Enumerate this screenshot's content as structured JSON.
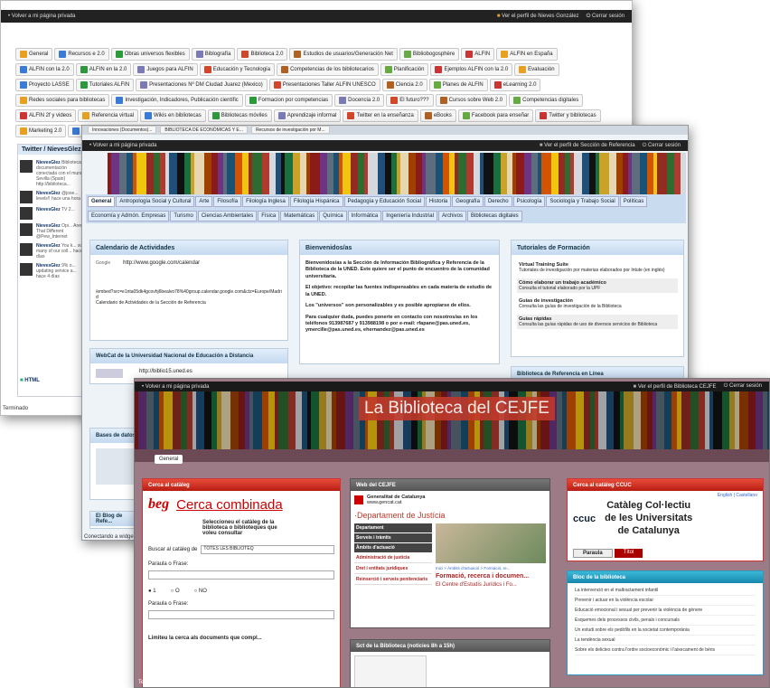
{
  "win1": {
    "topbar_left": "• Volver a mi página privada",
    "topbar_profile": "Ver el perfil de Nieves González",
    "topbar_logout": "Cerrar sesión",
    "tabs": [
      "General",
      "Recursos e 2.0",
      "Obras universos flexibles",
      "Biblografía",
      "Biblioteca 2.0",
      "Estudios de usuarios/Generación Net",
      "Bibliobogosphère",
      "ALFIN",
      "ALFIN en España",
      "ALFIN con la 2.0",
      "ALFIN en la 2.0",
      "Juegos para ALFIN",
      "Educación y Tecnología",
      "Competencias de los bibliotecarios",
      "Planificación",
      "Ejemplos ALFIN con la 2.0",
      "Evaluación",
      "Proyecto LASSE",
      "Tutoriales ALFIN",
      "Presentaciones Nº DM Ciudad Juarez (Mexico)",
      "Presentaciones Taller ALFIN UNESCO",
      "Ciencia 2.0",
      "Planes de ALFIN",
      "eLearning 2.0",
      "Redes sociales para bibliotecas",
      "Investigación, Indicadores, Publicación científic",
      "Formacion por competencias",
      "Docencia 2.0",
      "El futuro???",
      "Cursos sobre Web 2.0",
      "Competencias digitales",
      "ALFIN 2f y videos",
      "Referencia virtual",
      "Wikis en bibliotecas",
      "Bibliotecas móviles",
      "Aprendizaje informal",
      "Twitter en la enseñanza",
      "eBooks",
      "Facebook para enseñar",
      "Twitter y bibliotecas",
      "Marketing 2.0",
      "Futuro de la tecnología"
    ],
    "twitter_title": "Twitter / NievesGlez",
    "tweets": [
      {
        "user": "NievesGlez",
        "text": "Biblioteca y documentación conectada con el mundo: Sevilla (Spain) http://biblioteca..."
      },
      {
        "user": "NievesGlez",
        "text": "@jose... levels!! hace una hora"
      },
      {
        "user": "NievesGlez",
        "text": "TV 2..."
      },
      {
        "user": "NievesGlez",
        "text": "Opi... Aren't That Different @Pew_Internet"
      },
      {
        "user": "NievesGlez",
        "text": "You k... so many of our coll... hace 4 días"
      },
      {
        "user": "NievesGlez",
        "text": "9% o... updating service a... hace 4 días"
      }
    ],
    "html_label": "HTML",
    "status": "Terminado"
  },
  "win2": {
    "browser_tabs": [
      "Innovaciones (Documentos)...",
      "BIBLIOTECA DE ECONÓMICAS Y E...",
      "Recursos de investigación por M..."
    ],
    "topbar_left": "• Volver a mi página privada",
    "topbar_profile": "Ver el perfil de Sección de Referencia",
    "topbar_logout": "Cerrar sesión",
    "nav_row1": [
      "General",
      "Antropología Social y Cultural",
      "Arte",
      "Filosofía",
      "Filología Inglesa",
      "Filología Hispánica",
      "Pedagogía y Educación Social",
      "Historia",
      "Geografía",
      "Derecho",
      "Psicología",
      "Sociología y Trabajo Social",
      "Políticas"
    ],
    "nav_row2": [
      "Economía y Admón. Empresas",
      "Turismo",
      "Ciencias Ambientales",
      "Física",
      "Matemáticas",
      "Química",
      "Informática",
      "Ingeniería Industrial",
      "Archivos",
      "Bibliotecas digitales"
    ],
    "cal_title": "Calendario de Actividades",
    "cal_google": "Google",
    "cal_url": "http://www.google.com/calendar",
    "cal_embed": "/embed?src=e1nta05dk4gcovhj6bealvo78%40group.calendar.google.com&ctz=Europe/Madrid",
    "cal_caption": "Calendario de Actividades de la Sección de Referencia",
    "welcome_title": "Bienvenidos/as",
    "welcome_p1": "Bienvenidos/as a la Sección de Información Bibliográfica y Referencia de la Biblioteca de la UNED. Este quiere ser el punto de encuentro de la comunidad universitaria.",
    "welcome_p2": "El objetivo: recopilar las fuentes indispensables en cada materia de estudio de la UNED.",
    "welcome_p3": "Los \"universos\" son personalizables y es posible apropiarse de ellos.",
    "welcome_p4": "Para cualquier duda, puedes ponerte en contacto con nosotros/as en los teléfonos 913987687 y 913988198 o por e-mail: rfapane@pas.uned.es, ymercille@pas.uned.es, ehernandez@pas.uned.es",
    "tut_title": "Tutoriales de Formación",
    "tut_items": [
      {
        "h": "Virtual Training Suite",
        "d": "Tutoriales de investigación por materias elaborados por Intute (en inglés)"
      },
      {
        "h": "Cómo elaborar un trabajo académico",
        "d": "Consulta el tutorial elaborado por la UPF"
      },
      {
        "h": "Guías de investigación",
        "d": "Consulta las guías de investigación de la Biblioteca"
      },
      {
        "h": "Guías rápidas",
        "d": "Consulta las guías rápidas de uso de diversos servicios de Biblioteca"
      }
    ],
    "webcat_title": "WebCat de la Universidad Nacional de Educación a Distancia",
    "webcat_url": "http://biblio15.uned.es",
    "ref_title": "Biblioteca de Referencia en Línea",
    "bases_title": "Bases de datos",
    "blog_title": "El Blog de Refe...",
    "status": "Conectando a widget..."
  },
  "win3": {
    "topbar_left": "• Volver a mi página privada",
    "topbar_profile": "Ver el perfil de Biblioteca CEJFE",
    "topbar_logout": "Cerrar sesión",
    "banner_title": "La Biblioteca del CEJFE",
    "tab_general": "General",
    "catalog_title": "Cerca al catàleg",
    "catalog_logo": "beg",
    "catalog_heading": "Cerca combinada",
    "catalog_desc": "Seleccioneu el catàleg de la biblioteca o biblioteques que voleu consultar",
    "catalog_select_label": "Buscar al catàleg de",
    "catalog_select_value": "TOTES LES BIBLIOTEQ",
    "phrase_label": "Paraula o Frase:",
    "radio_1": "1",
    "radio_o": "O",
    "radio_no": "NO",
    "limit_text": "Limiteu la cerca als documents que compl...",
    "web_title": "Web del CEJFE",
    "web_gen_name": "Generalitat de Catalunya",
    "web_gen_url": "www.gencat.cat",
    "web_dept": "·Departament de Justícia",
    "web_menu": [
      "Departament",
      "Serveis i tràmits",
      "Àmbits d'actuació",
      "Administració de justícia",
      "Dret i entitats jurídiques",
      "Reinserció i serveis penitenciaris"
    ],
    "web_breadcrumb": "Inici > Àmbits d'actuació > Formació, re...",
    "web_heading": "Formació, recerca i documen...",
    "web_sub": "El Centre d'Estudis Jurídics i Fo...",
    "ccuc_title": "Cerca al catàleg CCUC",
    "ccuc_lang": "English | Castellano",
    "ccuc_logo": "ccuc",
    "ccuc_line1": "Catàleg Col·lectiu",
    "ccuc_line2": "de les Universitats",
    "ccuc_line3": "de Catalunya",
    "ccuc_tab1": "Paraula",
    "ccuc_tab2": "Títol",
    "blog_title": "Bloc de la biblioteca",
    "blog_items": [
      "La intervenció en el maltractament infantil",
      "Prevenir i actuar en la violència escolar",
      "Educació emocional i sexual per prevenir la violència de gènere",
      "Esquemes dels processos civils, penals i concursals",
      "Un estudi sobre els pedòfils en la societat contemporània",
      "La tendència sexual",
      "Sobre els delictes contra l'ordre socioeconòmic i l'aixecament de béns"
    ],
    "news_title": "Sct de la Biblioteca (notícies 8h a 15h)",
    "status": "Terminado"
  }
}
